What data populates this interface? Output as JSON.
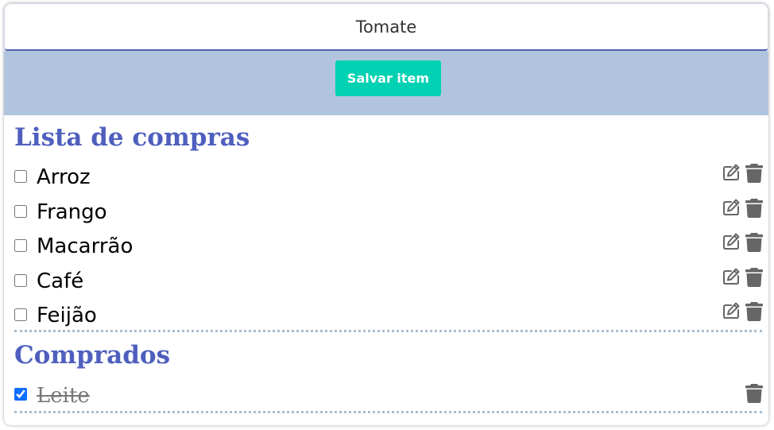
{
  "form": {
    "input_value": "Tomate",
    "save_label": "Salvar item"
  },
  "pending": {
    "title": "Lista de compras",
    "items": [
      {
        "label": "Arroz",
        "checked": false
      },
      {
        "label": "Frango",
        "checked": false
      },
      {
        "label": "Macarrão",
        "checked": false
      },
      {
        "label": "Café",
        "checked": false
      },
      {
        "label": "Feijão",
        "checked": false
      }
    ]
  },
  "done": {
    "title": "Comprados",
    "items": [
      {
        "label": "Leite",
        "checked": true
      }
    ]
  },
  "colors": {
    "accent": "#00d1b2",
    "title": "#4f5fbe",
    "header_bg": "#b0c4de",
    "icon": "#666666"
  },
  "icons": {
    "edit": "edit-icon",
    "delete": "trash-icon"
  }
}
